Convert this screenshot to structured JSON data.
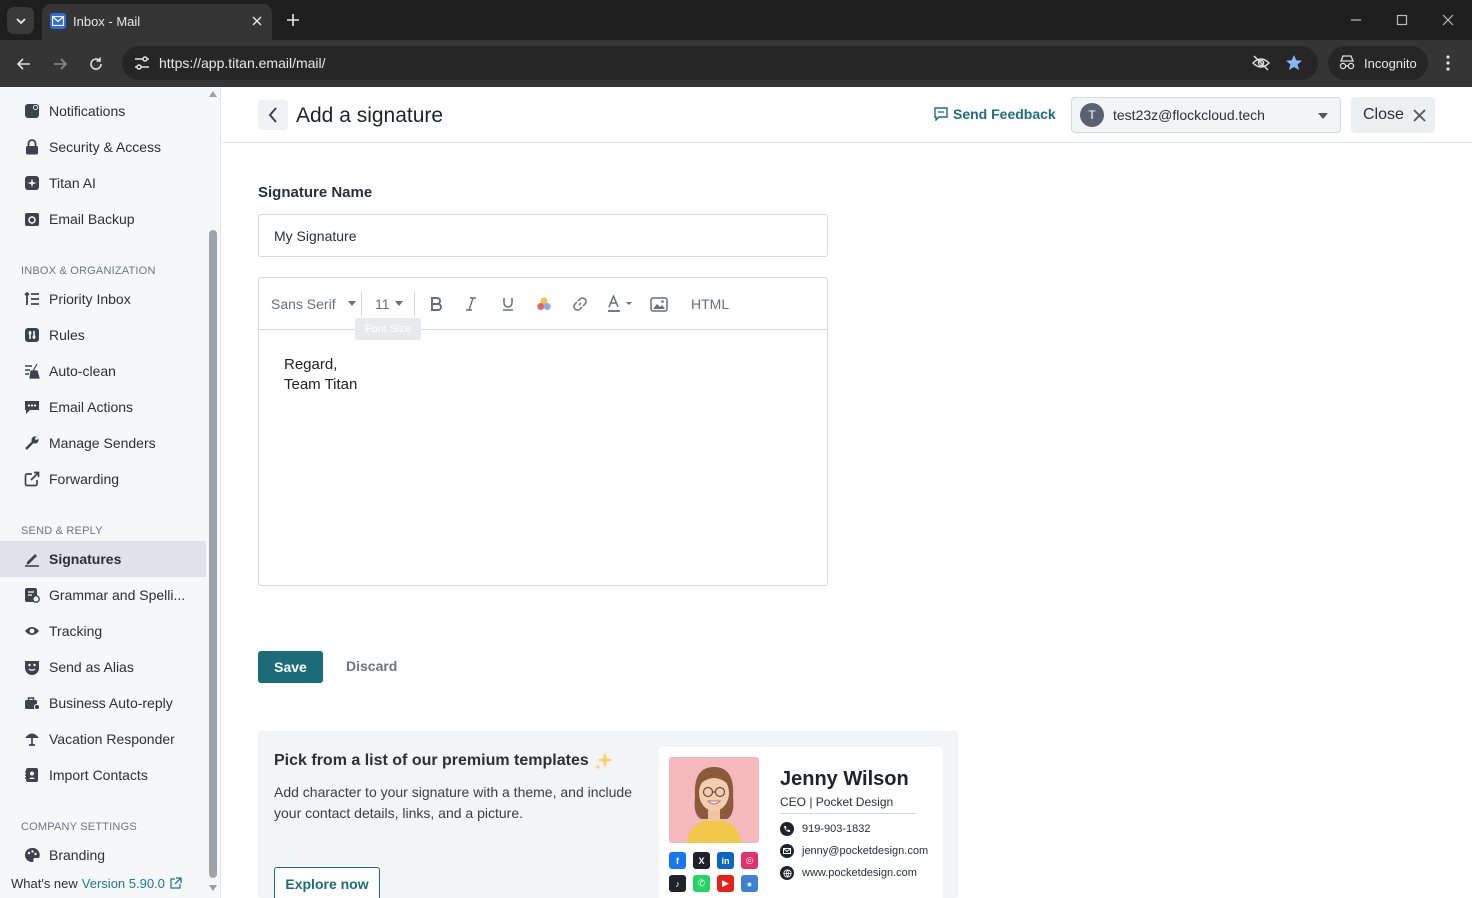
{
  "browser": {
    "tab_title": "Inbox - Mail",
    "url": "https://app.titan.email/mail/",
    "profile_label": "Incognito"
  },
  "sidebar": {
    "items_top": [
      {
        "label": "Notifications",
        "icon": "bell-icon"
      },
      {
        "label": "Security & Access",
        "icon": "lock-icon"
      },
      {
        "label": "Titan AI",
        "icon": "sparkle-icon"
      },
      {
        "label": "Email Backup",
        "icon": "backup-icon"
      }
    ],
    "section_inbox": "INBOX & ORGANIZATION",
    "items_inbox": [
      {
        "label": "Priority Inbox",
        "icon": "priority-list-icon"
      },
      {
        "label": "Rules",
        "icon": "rules-icon"
      },
      {
        "label": "Auto-clean",
        "icon": "broom-icon"
      },
      {
        "label": "Email Actions",
        "icon": "chat-actions-icon"
      },
      {
        "label": "Manage Senders",
        "icon": "wrench-icon"
      },
      {
        "label": "Forwarding",
        "icon": "forward-icon"
      }
    ],
    "section_send": "SEND & REPLY",
    "items_send": [
      {
        "label": "Signatures",
        "icon": "pen-icon"
      },
      {
        "label": "Grammar and Spelli...",
        "icon": "grammar-icon"
      },
      {
        "label": "Tracking",
        "icon": "eye-icon"
      },
      {
        "label": "Send as Alias",
        "icon": "alias-icon"
      },
      {
        "label": "Business Auto-reply",
        "icon": "briefcase-icon"
      },
      {
        "label": "Vacation Responder",
        "icon": "umbrella-icon"
      },
      {
        "label": "Import Contacts",
        "icon": "contacts-icon"
      }
    ],
    "section_company": "COMPANY SETTINGS",
    "items_company": [
      {
        "label": "Branding",
        "icon": "palette-icon"
      }
    ],
    "footer_label": "What's new",
    "footer_version": "Version 5.90.0"
  },
  "header": {
    "title": "Add a signature",
    "feedback_label": "Send Feedback",
    "account_initial": "T",
    "account_email": "test23z@flockcloud.tech",
    "close_label": "Close"
  },
  "form": {
    "name_label": "Signature Name",
    "name_value": "My Signature",
    "toolbar": {
      "font_family": "Sans Serif",
      "font_size": "11",
      "html_label": "HTML",
      "tooltip": "Font Size"
    },
    "body_lines": [
      "Regard,",
      "Team Titan"
    ],
    "save_label": "Save",
    "discard_label": "Discard"
  },
  "promo": {
    "title": "Pick from a list of our premium templates",
    "text": "Add character to your signature with a theme, and include your contact details, links, and a picture.",
    "cta_label": "Explore now",
    "card": {
      "name": "Jenny Wilson",
      "role": "CEO | Pocket Design",
      "phone": "919-903-1832",
      "email": "jenny@pocketdesign.com",
      "website": "www.pocketdesign.com",
      "socials": [
        "facebook-icon",
        "x-icon",
        "linkedin-icon",
        "instagram-icon",
        "tiktok-icon",
        "whatsapp-icon",
        "youtube-icon",
        "location-icon"
      ]
    }
  },
  "colors": {
    "accent": "#1b6b78",
    "sidebar_bg": "#f6f7f8",
    "active_item_bg": "#dfe2e6",
    "chrome_bg": "#1f1f1f"
  }
}
